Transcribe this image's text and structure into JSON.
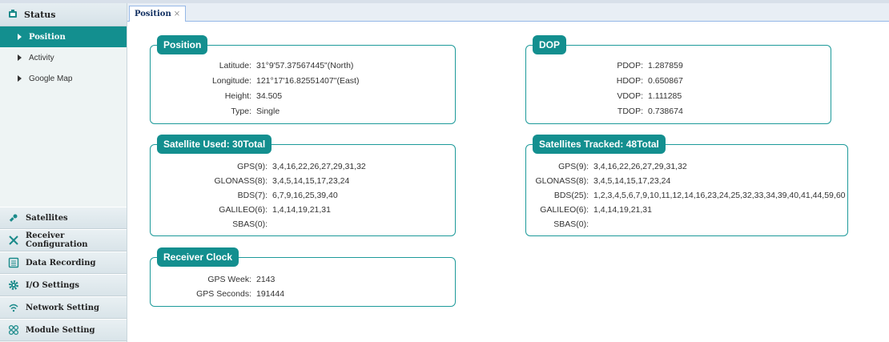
{
  "sidebar": {
    "status_label": "Status",
    "sub_items": [
      {
        "label": "Position",
        "active": true
      },
      {
        "label": "Activity",
        "active": false
      },
      {
        "label": "Google Map",
        "active": false
      }
    ],
    "menu": [
      {
        "label": "Satellites",
        "icon": "satellite-icon"
      },
      {
        "label": "Receiver Configuration",
        "icon": "tools-icon"
      },
      {
        "label": "Data Recording",
        "icon": "list-icon"
      },
      {
        "label": "I/O Settings",
        "icon": "gear-icon"
      },
      {
        "label": "Network Setting",
        "icon": "wifi-icon"
      },
      {
        "label": "Module Setting",
        "icon": "module-icon"
      }
    ]
  },
  "tabs": [
    {
      "label": "Position",
      "close": "×"
    }
  ],
  "position": {
    "title": "Position",
    "rows": [
      {
        "label": "Latitude:",
        "value": "31°9'57.37567445\"(North)"
      },
      {
        "label": "Longitude:",
        "value": "121°17'16.82551407\"(East)"
      },
      {
        "label": "Height:",
        "value": "34.505"
      },
      {
        "label": "Type:",
        "value": "Single"
      }
    ]
  },
  "dop": {
    "title": "DOP",
    "rows": [
      {
        "label": "PDOP:",
        "value": "1.287859"
      },
      {
        "label": "HDOP:",
        "value": "0.650867"
      },
      {
        "label": "VDOP:",
        "value": "1.111285"
      },
      {
        "label": "TDOP:",
        "value": "0.738674"
      }
    ]
  },
  "sat_used": {
    "title": "Satellite Used:  30Total",
    "rows": [
      {
        "label": "GPS(9):",
        "value": "3,4,16,22,26,27,29,31,32"
      },
      {
        "label": "GLONASS(8):",
        "value": "3,4,5,14,15,17,23,24"
      },
      {
        "label": "BDS(7):",
        "value": "6,7,9,16,25,39,40"
      },
      {
        "label": "GALILEO(6):",
        "value": "1,4,14,19,21,31"
      },
      {
        "label": "SBAS(0):",
        "value": ""
      }
    ]
  },
  "sat_tracked": {
    "title": "Satellites Tracked:  48Total",
    "rows": [
      {
        "label": "GPS(9):",
        "value": "3,4,16,22,26,27,29,31,32"
      },
      {
        "label": "GLONASS(8):",
        "value": "3,4,5,14,15,17,23,24"
      },
      {
        "label": "BDS(25):",
        "value": "1,2,3,4,5,6,7,9,10,11,12,14,16,23,24,25,32,33,34,39,40,41,44,59,60"
      },
      {
        "label": "GALILEO(6):",
        "value": "1,4,14,19,21,31"
      },
      {
        "label": "SBAS(0):",
        "value": ""
      }
    ]
  },
  "clock": {
    "title": "Receiver Clock",
    "rows": [
      {
        "label": "GPS Week:",
        "value": "2143"
      },
      {
        "label": "GPS Seconds:",
        "value": "191444"
      }
    ]
  }
}
